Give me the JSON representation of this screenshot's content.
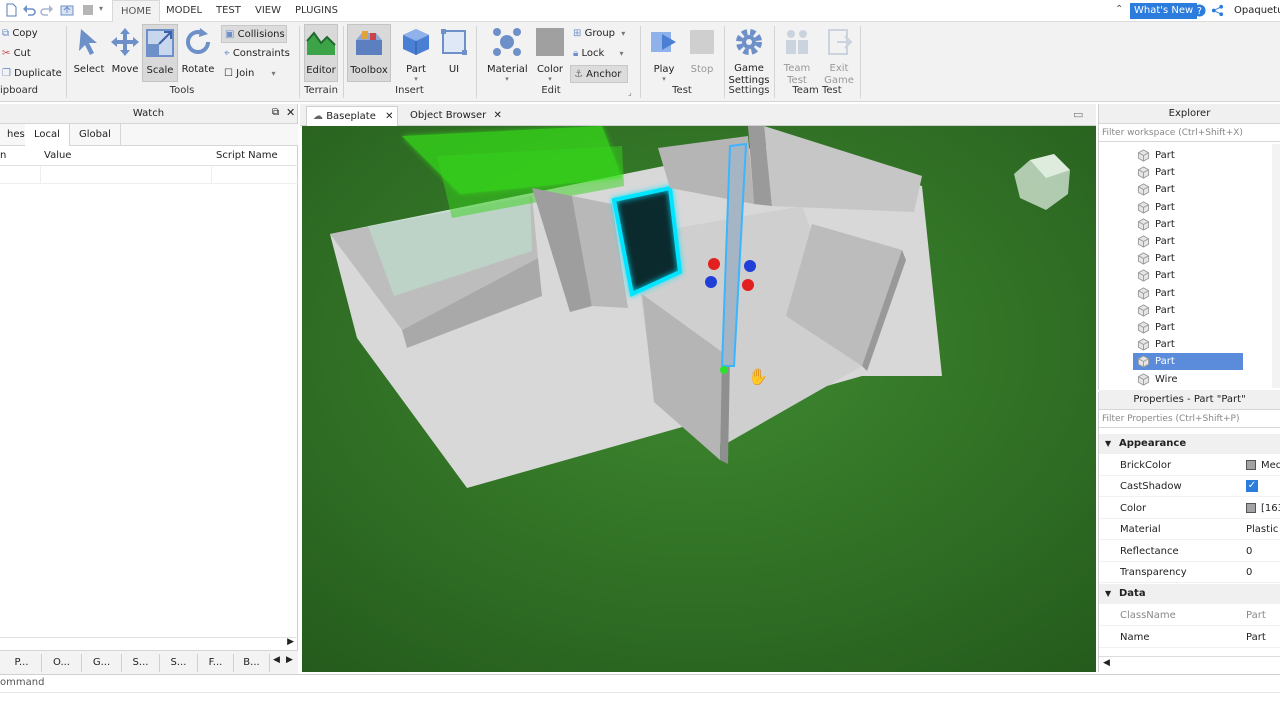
{
  "menubar": {
    "tabs": [
      "HOME",
      "MODEL",
      "TEST",
      "VIEW",
      "PLUGINS"
    ],
    "active_tab": "HOME",
    "whats_new": "What's New",
    "username": "Opaquetu"
  },
  "ribbon": {
    "clipboard": {
      "copy": "Copy",
      "cut": "Cut",
      "duplicate": "Duplicate",
      "label": "ipboard"
    },
    "tools": {
      "select": "Select",
      "move": "Move",
      "scale": "Scale",
      "rotate": "Rotate",
      "collisions": "Collisions",
      "constraints": "Constraints",
      "join": "Join",
      "label": "Tools"
    },
    "terrain": {
      "editor": "Editor",
      "label": "Terrain"
    },
    "insert": {
      "toolbox": "Toolbox",
      "part": "Part",
      "ui": "UI",
      "label": "Insert"
    },
    "edit": {
      "material": "Material",
      "color": "Color",
      "group": "Group",
      "lock": "Lock",
      "anchor": "Anchor",
      "label": "Edit"
    },
    "test": {
      "play": "Play",
      "stop": "Stop",
      "label": "Test"
    },
    "settings": {
      "game_settings_1": "Game",
      "game_settings_2": "Settings",
      "label": "Settings"
    },
    "team_test": {
      "team_test_1": "Team",
      "team_test_2": "Test",
      "exit_game_1": "Exit",
      "exit_game_2": "Game",
      "label": "Team Test"
    }
  },
  "watch": {
    "title": "Watch",
    "tabs": [
      "hes",
      "Local",
      "Global"
    ],
    "columns": [
      "n",
      "Value",
      "Script Name"
    ],
    "bottom_tabs": [
      "P...",
      "O...",
      "G...",
      "S...",
      "S...",
      "F...",
      "B..."
    ]
  },
  "documents": {
    "tabs": [
      "Baseplate",
      "Object Browser"
    ]
  },
  "explorer": {
    "title": "Explorer",
    "filter_placeholder": "Filter workspace (Ctrl+Shift+X)",
    "items": [
      "Part",
      "Part",
      "Part",
      "Part",
      "Part",
      "Part",
      "Part",
      "Part",
      "Part",
      "Part",
      "Part",
      "Part",
      "Part",
      "Wire"
    ],
    "selected_index": 12
  },
  "properties": {
    "title": "Properties - Part \"Part\"",
    "filter_placeholder": "Filter Properties (Ctrl+Shift+P)",
    "appearance_label": "Appearance",
    "brickcolor_name": "BrickColor",
    "brickcolor_value": "Med",
    "castshadow_name": "CastShadow",
    "color_name": "Color",
    "color_value": "[163",
    "material_name": "Material",
    "material_value": "Plastic",
    "reflectance_name": "Reflectance",
    "reflectance_value": "0",
    "transparency_name": "Transparency",
    "transparency_value": "0",
    "data_label": "Data",
    "classname_name": "ClassName",
    "classname_value": "Part",
    "name_name": "Name",
    "name_value": "Part",
    "swatch_color": "#a3a2a5"
  },
  "commandbar": {
    "text": "ommand"
  },
  "colors": {
    "accent": "#2b7cdc",
    "selection": "#5b8cdb",
    "neon_green": "#39ff14",
    "neon_cyan": "#00e5ff",
    "grass": "#2f6b25",
    "wall": "#bdbdbd"
  }
}
